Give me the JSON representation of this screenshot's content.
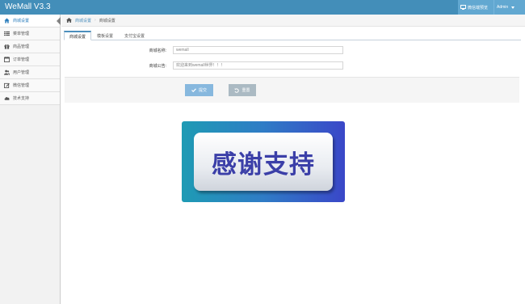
{
  "header": {
    "brand": "WeMall V3.3",
    "preview_label": "微信端预览",
    "user_label": "Admin"
  },
  "sidebar": {
    "items": [
      {
        "label": "商城设置",
        "icon": "home-icon",
        "active": true
      },
      {
        "label": "菜单管理",
        "icon": "list-icon",
        "active": false
      },
      {
        "label": "商品管理",
        "icon": "gift-icon",
        "active": false
      },
      {
        "label": "订单管理",
        "icon": "calendar-icon",
        "active": false
      },
      {
        "label": "用户管理",
        "icon": "users-icon",
        "active": false
      },
      {
        "label": "微信管理",
        "icon": "edit-icon",
        "active": false
      },
      {
        "label": "技术支持",
        "icon": "cloud-icon",
        "active": false
      }
    ]
  },
  "breadcrumb": {
    "root": "商城设置",
    "current": "商城设置"
  },
  "tabs": [
    "商城设置",
    "模板设置",
    "支付宝设置"
  ],
  "form": {
    "name_label": "商城名称:",
    "name_value": "wemall",
    "notice_label": "商城公告:",
    "notice_value": "欢迎来到wemall世界！！！"
  },
  "actions": {
    "submit_label": "提交",
    "reset_label": "重置"
  },
  "banner": {
    "text": "感谢支持"
  },
  "colors": {
    "header": "#438eb9",
    "accent": "#4c8fbd",
    "submit": "#87b8de",
    "reset": "#abbac3"
  }
}
